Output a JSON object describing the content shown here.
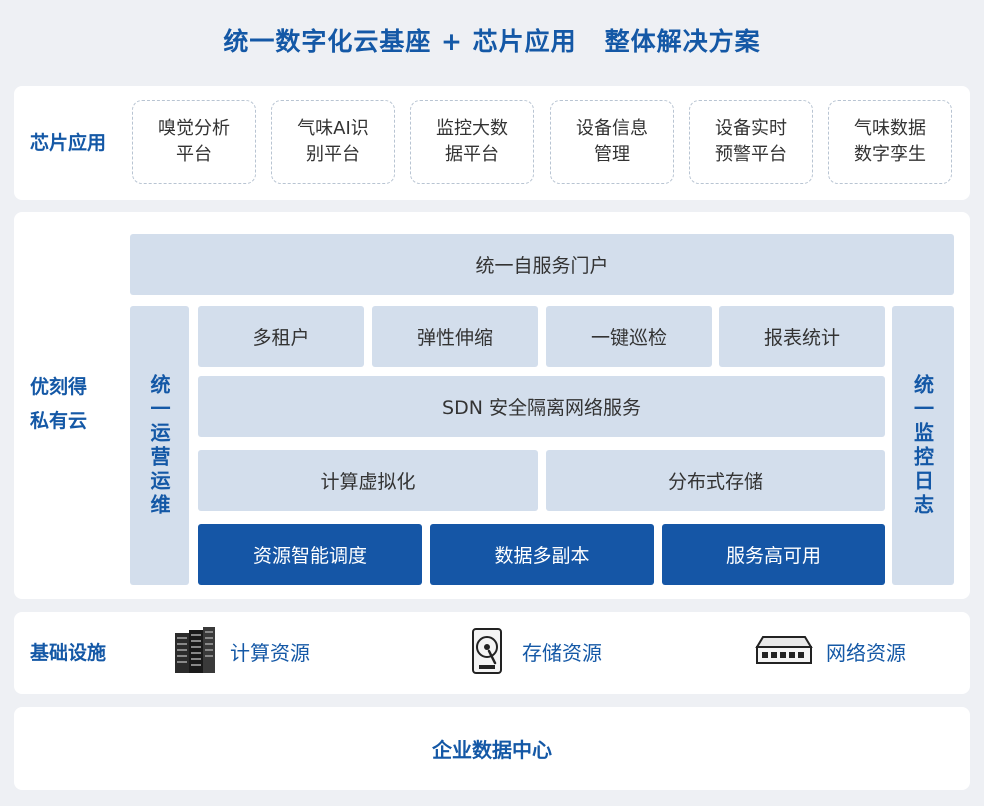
{
  "title": {
    "left": "统一数字化云基座 + 芯片应用",
    "right": "整体解决方案"
  },
  "chip_apps": {
    "label": "芯片应用",
    "items": [
      {
        "line1": "嗅觉分析",
        "line2": "平台"
      },
      {
        "line1": "气味AI识",
        "line2": "别平台"
      },
      {
        "line1": "监控大数",
        "line2": "据平台"
      },
      {
        "line1": "设备信息",
        "line2": "管理"
      },
      {
        "line1": "设备实时",
        "line2": "预警平台"
      },
      {
        "line1": "气味数据",
        "line2": "数字孪生"
      }
    ]
  },
  "private_cloud": {
    "label_line1": "优刻得",
    "label_line2": "私有云",
    "portal": "统一自服务门户",
    "left_column": "统一运营运维",
    "right_column": "统一监控日志",
    "services_row": [
      "多租户",
      "弹性伸缩",
      "一键巡检",
      "报表统计"
    ],
    "sdn": "SDN 安全隔离网络服务",
    "virt_row": [
      "计算虚拟化",
      "分布式存储"
    ],
    "core_row": [
      "资源智能调度",
      "数据多副本",
      "服务高可用"
    ],
    "colors": {
      "light": "#d3deec",
      "dark": "#1556a6",
      "accent": "#1458a6"
    }
  },
  "infrastructure": {
    "label": "基础设施",
    "items": [
      {
        "icon": "server-rack-icon",
        "label": "计算资源"
      },
      {
        "icon": "hard-disk-icon",
        "label": "存储资源"
      },
      {
        "icon": "network-switch-icon",
        "label": "网络资源"
      }
    ]
  },
  "datacenter": {
    "label": "企业数据中心"
  }
}
